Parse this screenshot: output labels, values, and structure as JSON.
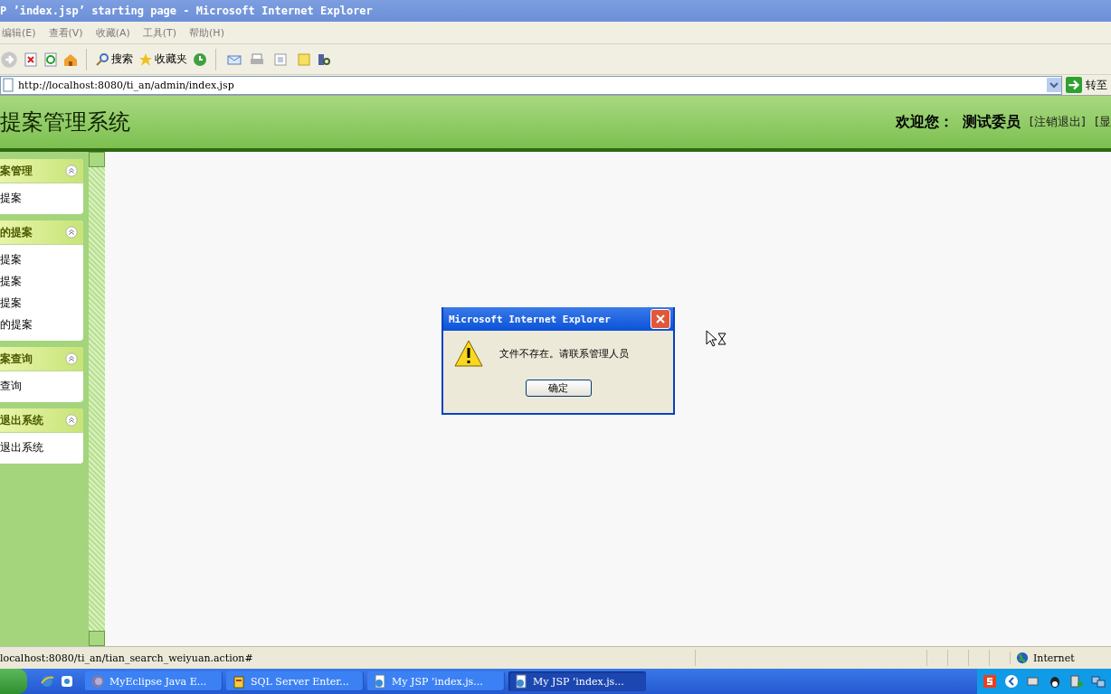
{
  "window": {
    "title": "P ’index.jsp’ starting page - Microsoft Internet Explorer"
  },
  "menu": [
    "编辑(E)",
    "查看(V)",
    "收藏(A)",
    "工具(T)",
    "帮助(H)"
  ],
  "toolbar": {
    "search_label": "搜索",
    "favorites_label": "收藏夹"
  },
  "address": {
    "url": "http://localhost:8080/ti_an/admin/index.jsp",
    "go_label": "转至"
  },
  "header": {
    "title": "提案管理系统",
    "welcome_label": "欢迎您：",
    "user_name": "测试委员",
    "links": [
      "[注销退出]",
      "[显"
    ]
  },
  "sidebar": {
    "sections": [
      {
        "title": "案管理",
        "items": [
          "提案"
        ]
      },
      {
        "title": "的提案",
        "items": [
          "提案",
          "提案",
          "提案",
          "的提案"
        ]
      },
      {
        "title": "案查询",
        "items": [
          "查询"
        ]
      },
      {
        "title": "退出系统",
        "items": [
          "退出系统"
        ]
      }
    ]
  },
  "dialog": {
    "title": "Microsoft Internet Explorer",
    "message": "文件不存在。请联系管理人员",
    "button": "确定"
  },
  "status_bar": {
    "text": "localhost:8080/ti_an/tian_search_weiyuan.action#",
    "zone": "Internet"
  },
  "taskbar": {
    "items": [
      {
        "label": "MyEclipse Java E...",
        "kind": "eclipse",
        "selected": false
      },
      {
        "label": "SQL Server Enter...",
        "kind": "database",
        "selected": false
      },
      {
        "label": "My JSP ’index.js...",
        "kind": "browser",
        "selected": false
      },
      {
        "label": "My JSP ’index.js...",
        "kind": "browser",
        "selected": true
      }
    ]
  }
}
